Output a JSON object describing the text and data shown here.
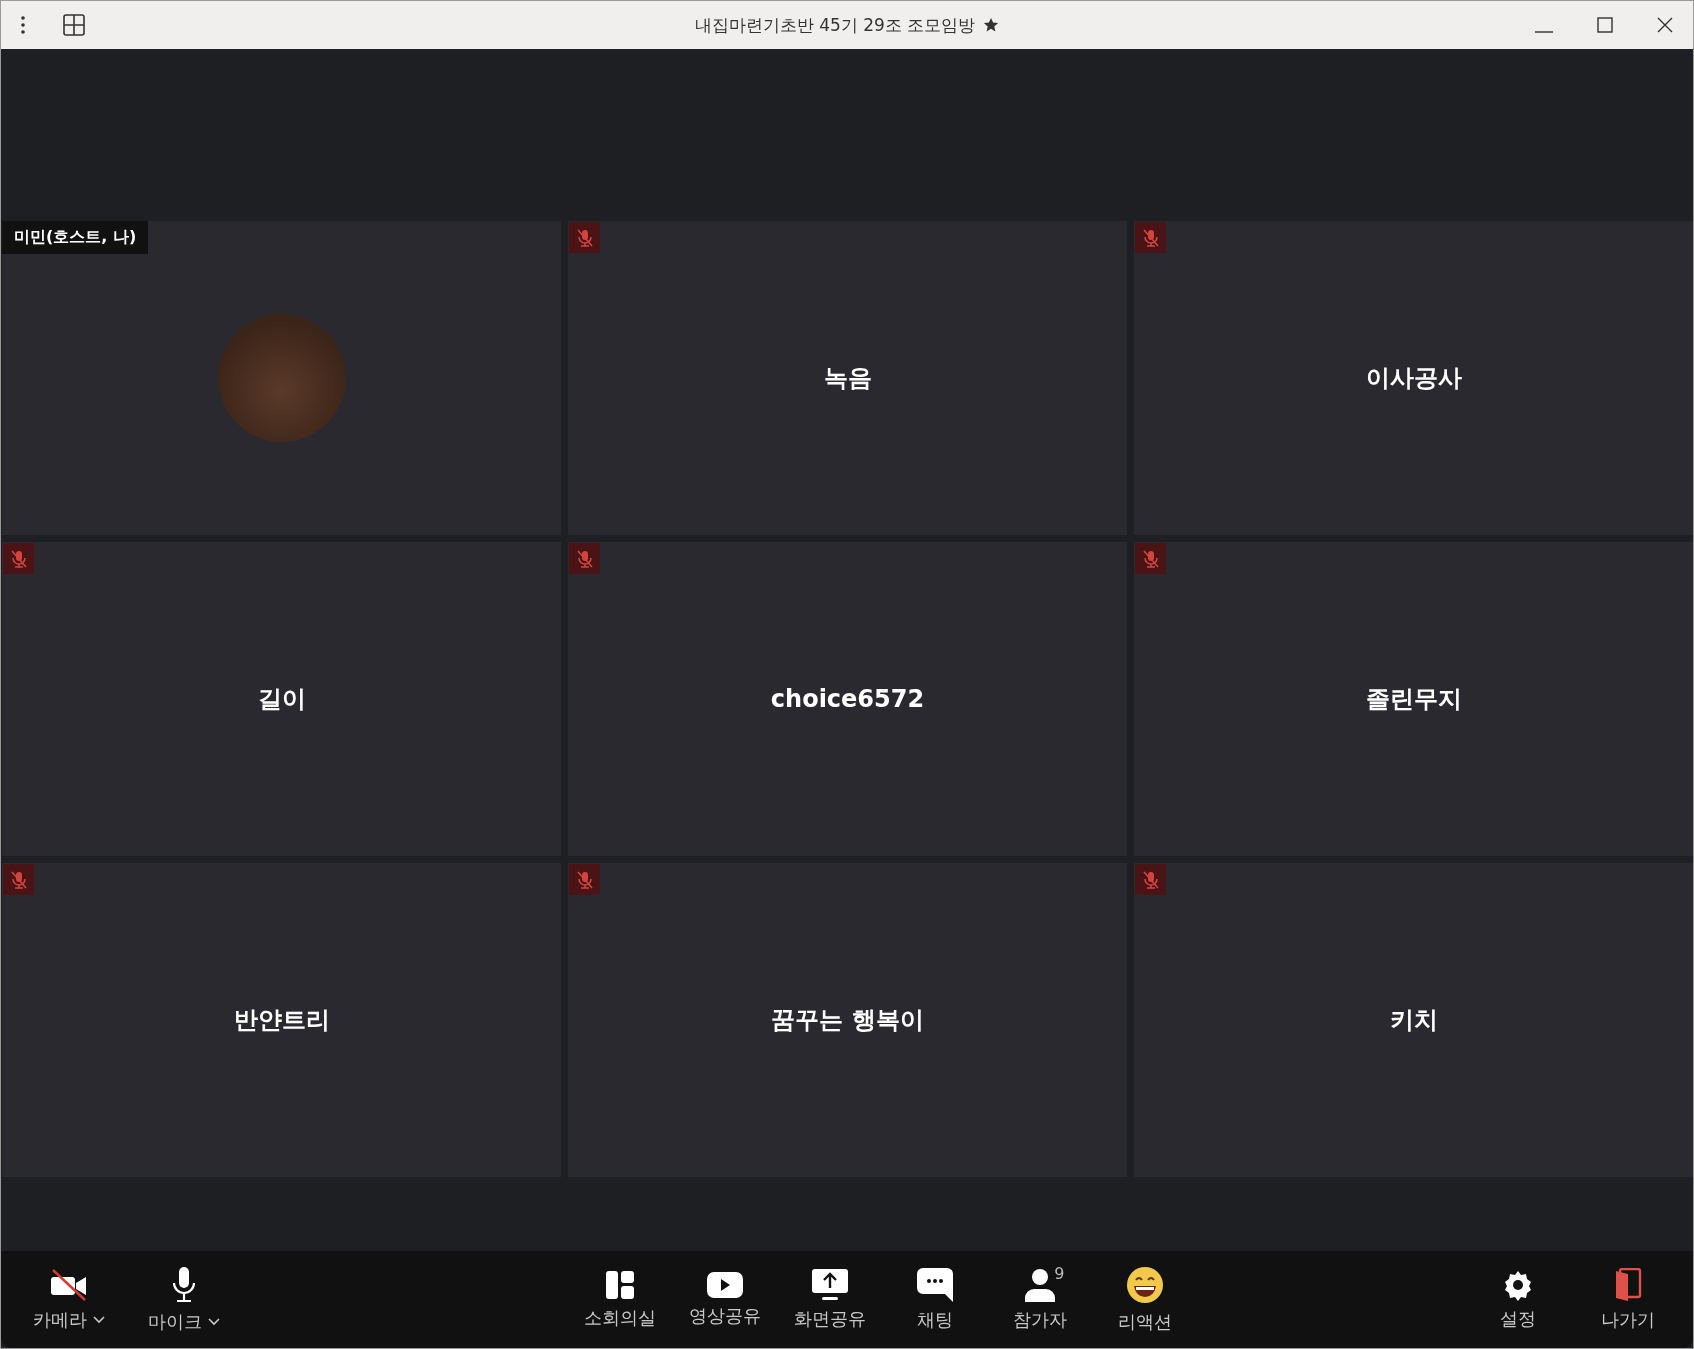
{
  "window": {
    "title": "내집마련기초반 45기 29조 조모임방",
    "starred": true
  },
  "tiles": [
    {
      "kind": "photo",
      "name": "미민(호스트, 나)",
      "muted": false
    },
    {
      "kind": "name",
      "name": "녹음",
      "muted": true
    },
    {
      "kind": "name",
      "name": "이사공사",
      "muted": true
    },
    {
      "kind": "name",
      "name": "길이",
      "muted": true
    },
    {
      "kind": "name",
      "name": "choice6572",
      "muted": true
    },
    {
      "kind": "name",
      "name": "졸린무지",
      "muted": true
    },
    {
      "kind": "name",
      "name": "반얀트리",
      "muted": true
    },
    {
      "kind": "name",
      "name": "꿈꾸는 행복이",
      "muted": true
    },
    {
      "kind": "name",
      "name": "키치",
      "muted": true
    }
  ],
  "toolbar": {
    "left": [
      {
        "kind": "camera",
        "label": "카메라",
        "off": true
      },
      {
        "kind": "mic",
        "label": "마이크",
        "off": false
      }
    ],
    "center": [
      {
        "kind": "breakout",
        "label": "소회의실"
      },
      {
        "kind": "video",
        "label": "영상공유"
      },
      {
        "kind": "screen",
        "label": "화면공유"
      },
      {
        "kind": "chat",
        "label": "채팅"
      },
      {
        "kind": "people",
        "label": "참가자",
        "count": "9"
      },
      {
        "kind": "reaction",
        "label": "리액션"
      }
    ],
    "right": [
      {
        "kind": "settings",
        "label": "설정"
      },
      {
        "kind": "leave",
        "label": "나가기"
      }
    ]
  }
}
